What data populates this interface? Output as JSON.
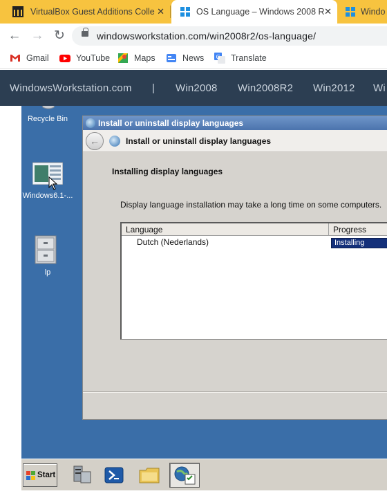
{
  "browser": {
    "tabs": [
      {
        "title": "VirtualBox Guest Additions Colle",
        "close": "✕",
        "active": false
      },
      {
        "title": "OS Language – Windows 2008 R",
        "close": "✕",
        "active": true
      },
      {
        "title": "Windo",
        "active": false
      }
    ],
    "nav": {
      "back": "←",
      "forward": "→",
      "reload": "↻"
    },
    "url": "windowsworkstation.com/win2008r2/os-language/",
    "bookmarks": [
      "Gmail",
      "YouTube",
      "Maps",
      "News",
      "Translate"
    ]
  },
  "site_nav": {
    "brand": "WindowsWorkstation.com",
    "separator": "|",
    "items": [
      "Win2008",
      "Win2008R2",
      "Win2012",
      "Wi"
    ]
  },
  "desktop": {
    "icons": [
      {
        "label": "Recycle Bin"
      },
      {
        "label": "Windows6.1-..."
      },
      {
        "label": "lp"
      }
    ]
  },
  "dialog": {
    "title": "Install or uninstall display languages",
    "header": "Install or uninstall display languages",
    "back_glyph": "←",
    "section_heading": "Installing display languages",
    "info": "Display language installation may take a long time on some computers.",
    "columns": [
      "Language",
      "Progress"
    ],
    "rows": [
      {
        "language": "Dutch (Nederlands)",
        "progress": "Installing"
      }
    ]
  },
  "taskbar": {
    "start_label": "Start"
  },
  "colors": {
    "tab_strip": "#f7c33f",
    "site_nav": "#2c3e52",
    "desktop": "#3a6ea8",
    "progress": "#14307a"
  }
}
